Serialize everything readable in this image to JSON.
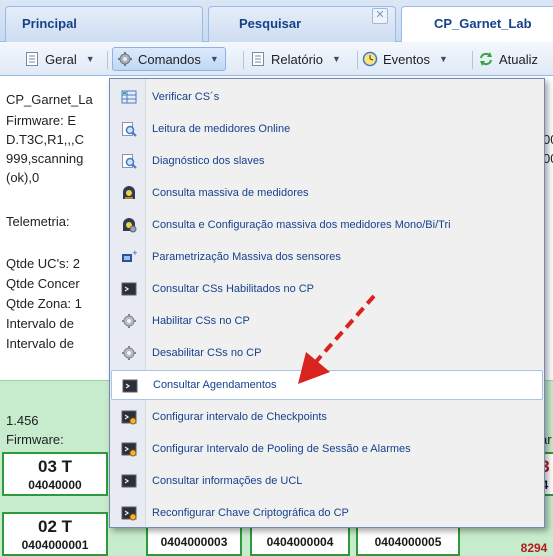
{
  "tabs": [
    {
      "label": "Principal"
    },
    {
      "label": "Pesquisar",
      "close": "✕"
    },
    {
      "label": "CP_Garnet_Lab"
    }
  ],
  "toolbar": {
    "geral": "Geral",
    "comandos": "Comandos",
    "relatorio": "Relatório",
    "eventos": "Eventos",
    "atualizar": "Atualiz"
  },
  "background": {
    "lines": [
      "CP_Garnet_La",
      "Firmware: E",
      "D.T3C,R1,,,C",
      "999,scanning",
      "(ok),0",
      "Telemetria:",
      "Qtde UC's: 2",
      "Qtde Concer",
      "Qtde Zona: 1",
      "Intervalo de",
      "Intervalo de"
    ],
    "right_fragments": [
      "00",
      "00"
    ]
  },
  "green_panel": {
    "value": "1.456",
    "firmware": "Firmware:",
    "right_fragment": "ar",
    "cards": [
      {
        "big": "03 T",
        "small": "04040000"
      },
      {
        "big": "3",
        "small": "4"
      },
      {
        "big": "02 T",
        "small": "0404000001"
      },
      {
        "big": "",
        "small": "0404000003"
      },
      {
        "big": "",
        "small": "0404000004"
      },
      {
        "big": "",
        "small": "0404000005"
      },
      {
        "big": "",
        "small": "8294"
      }
    ]
  },
  "menu": {
    "items": [
      {
        "label": "Verificar CS´s",
        "icon": "grid-icon"
      },
      {
        "label": "Leitura de medidores Online",
        "icon": "magnifier-doc-icon"
      },
      {
        "label": "Diagnóstico dos slaves",
        "icon": "magnifier-doc-icon"
      },
      {
        "label": "Consulta massiva de medidores",
        "icon": "meter-icon"
      },
      {
        "label": "Consulta e Configuração massiva dos medidores Mono/Bi/Tri",
        "icon": "meter-config-icon"
      },
      {
        "label": "Parametrização Massiva dos sensores",
        "icon": "sensor-icon"
      },
      {
        "label": "Consultar CSs Habilitados no CP",
        "icon": "terminal-icon"
      },
      {
        "label": "Habilitar CSs no CP",
        "icon": "gear-icon"
      },
      {
        "label": "Desabilitar CSs no CP",
        "icon": "gear-icon"
      },
      {
        "label": "Consultar Agendamentos",
        "icon": "terminal-icon"
      },
      {
        "label": "Configurar intervalo de Checkpoints",
        "icon": "terminal-gear-icon"
      },
      {
        "label": "Configurar Intervalo de Pooling de Sessão e Alarmes",
        "icon": "terminal-gear-icon"
      },
      {
        "label": "Consultar informações de UCL",
        "icon": "terminal-icon"
      },
      {
        "label": "Reconfigurar Chave Criptográfica do CP",
        "icon": "terminal-gear-icon"
      }
    ],
    "highlighted_index": 9
  },
  "colors": {
    "accent": "#15428b",
    "panel_green": "#c7ebcd",
    "card_border": "#2f9a3b",
    "arrow_red": "#d9231e"
  }
}
